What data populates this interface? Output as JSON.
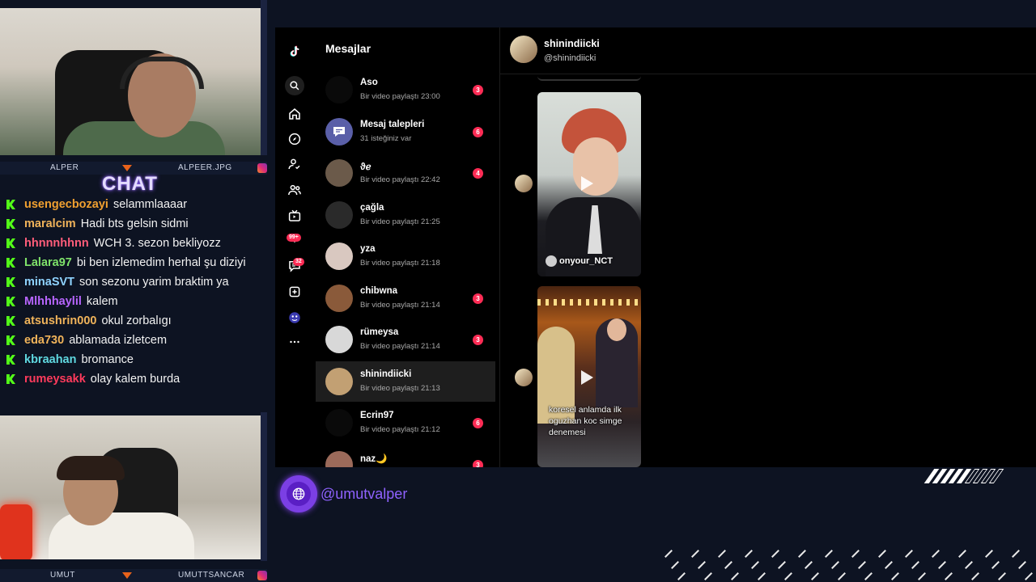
{
  "webcam_top": {
    "left_name": "ALPER",
    "right_name": "ALPEER.JPG"
  },
  "webcam_bottom": {
    "left_name": "UMUT",
    "right_name": "UMUTTSANCAR"
  },
  "chat": {
    "title": "CHAT",
    "messages": [
      {
        "user": "usengecbozayi",
        "color": "#f0a030",
        "text": "selammlaaaar"
      },
      {
        "user": "maralcim",
        "color": "#f0b35a",
        "text": "Hadi bts gelsin sidmi"
      },
      {
        "user": "hhnnnhhnn",
        "color": "#ff5d7a",
        "text": "WCH 3. sezon bekliyozz"
      },
      {
        "user": "Lalara97",
        "color": "#7fe36a",
        "text": "bi ben izlemedim herhal şu diziyi"
      },
      {
        "user": "minaSVT",
        "color": "#8fd3ff",
        "text": "son sezonu yarim braktim ya"
      },
      {
        "user": "Mlhhhaylil",
        "color": "#b865ff",
        "text": "kalem"
      },
      {
        "user": "atsushrin000",
        "color": "#f0b35a",
        "text": "okul zorbalıgı"
      },
      {
        "user": "eda730",
        "color": "#f0b35a",
        "text": "ablamada izletcem"
      },
      {
        "user": "kbraahan",
        "color": "#5fd8e0",
        "text": "bromance"
      },
      {
        "user": "rumeysakk",
        "color": "#ff3b5c",
        "text": "olay kalem burda"
      }
    ]
  },
  "tiktok": {
    "nav_icons": [
      "tiktok-logo",
      "search-icon",
      "home-icon",
      "explore-icon",
      "following-icon",
      "friends-icon",
      "live-icon",
      "activity-icon",
      "messages-icon",
      "upload-icon",
      "profile-icon",
      "more-icon"
    ],
    "activity_badge": "99+",
    "messages_badge": "32",
    "list_title": "Mesajlar",
    "conversations": [
      {
        "name": "Aso",
        "sub": "Bir video paylaştı 23:00",
        "count": "3"
      },
      {
        "name": "Mesaj talepleri",
        "sub": "31 isteğiniz var",
        "count": "6"
      },
      {
        "name": "ϑℯ",
        "sub": "Bir video paylaştı 22:42",
        "count": "4"
      },
      {
        "name": "çağla",
        "sub": "Bir video paylaştı 21:25",
        "count": ""
      },
      {
        "name": "yza",
        "sub": "Bir video paylaştı 21:18",
        "count": ""
      },
      {
        "name": "chibwna",
        "sub": "Bir video paylaştı 21:14",
        "count": "3"
      },
      {
        "name": "rümeysa",
        "sub": "Bir video paylaştı 21:14",
        "count": "3"
      },
      {
        "name": "shinindiicki",
        "sub": "Bir video paylaştı 21:13",
        "count": ""
      },
      {
        "name": "Ecrin97",
        "sub": "Bir video paylaştı 21:12",
        "count": "6"
      },
      {
        "name": "naz🌙",
        "sub": "",
        "count": "3"
      }
    ],
    "active_chat": {
      "name": "shinindiicki",
      "handle": "@shinindiicki",
      "videos": [
        {
          "author": "onyour_NCT",
          "overlay": ""
        },
        {
          "author": "",
          "overlay": "koresel anlamda ilk oguzhan koc simge denemesi"
        }
      ]
    }
  },
  "stream_handle": "@umutvalper"
}
